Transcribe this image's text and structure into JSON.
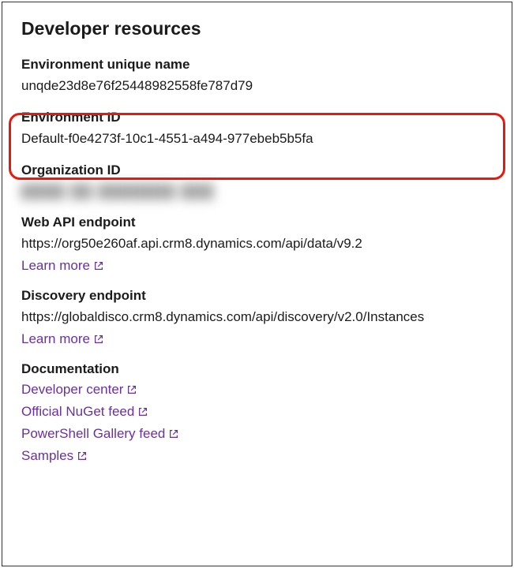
{
  "title": "Developer resources",
  "sections": {
    "uniqueName": {
      "label": "Environment unique name",
      "value": "unqde23d8e76f25448982558fe787d79"
    },
    "envId": {
      "label": "Environment ID",
      "value": "Default-f0e4273f-10c1-4551-a494-977ebeb5b5fa"
    },
    "orgId": {
      "label": "Organization ID",
      "value": "████ ██ ███████ ███"
    },
    "webApi": {
      "label": "Web API endpoint",
      "value": "https://org50e260af.api.crm8.dynamics.com/api/data/v9.2",
      "learnMore": "Learn more"
    },
    "discovery": {
      "label": "Discovery endpoint",
      "value": "https://globaldisco.crm8.dynamics.com/api/discovery/v2.0/Instances",
      "learnMore": "Learn more"
    },
    "docs": {
      "label": "Documentation",
      "links": [
        "Developer center",
        "Official NuGet feed",
        "PowerShell Gallery feed",
        "Samples"
      ]
    }
  }
}
